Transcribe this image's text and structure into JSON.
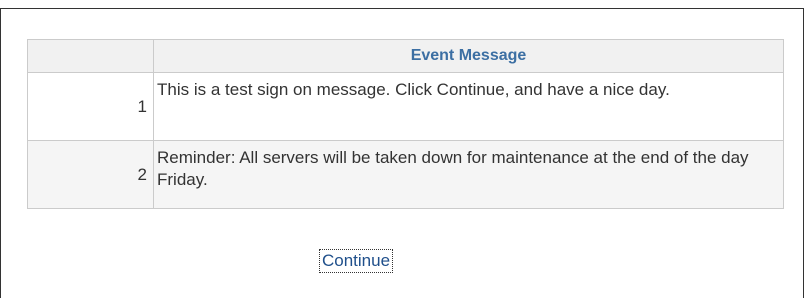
{
  "table": {
    "number_header": "",
    "message_header": "Event Message",
    "rows": [
      {
        "number": "1",
        "message": "This is a test sign on message. Click Continue, and have a nice day."
      },
      {
        "number": "2",
        "message": "Reminder: All servers will be taken down for maintenance at the end of the day Friday."
      }
    ]
  },
  "actions": {
    "continue_label": "Continue"
  },
  "colors": {
    "header_text": "#3c6fa3",
    "link": "#1f4f8b",
    "border": "#cbcbcb",
    "frame": "#333333"
  }
}
